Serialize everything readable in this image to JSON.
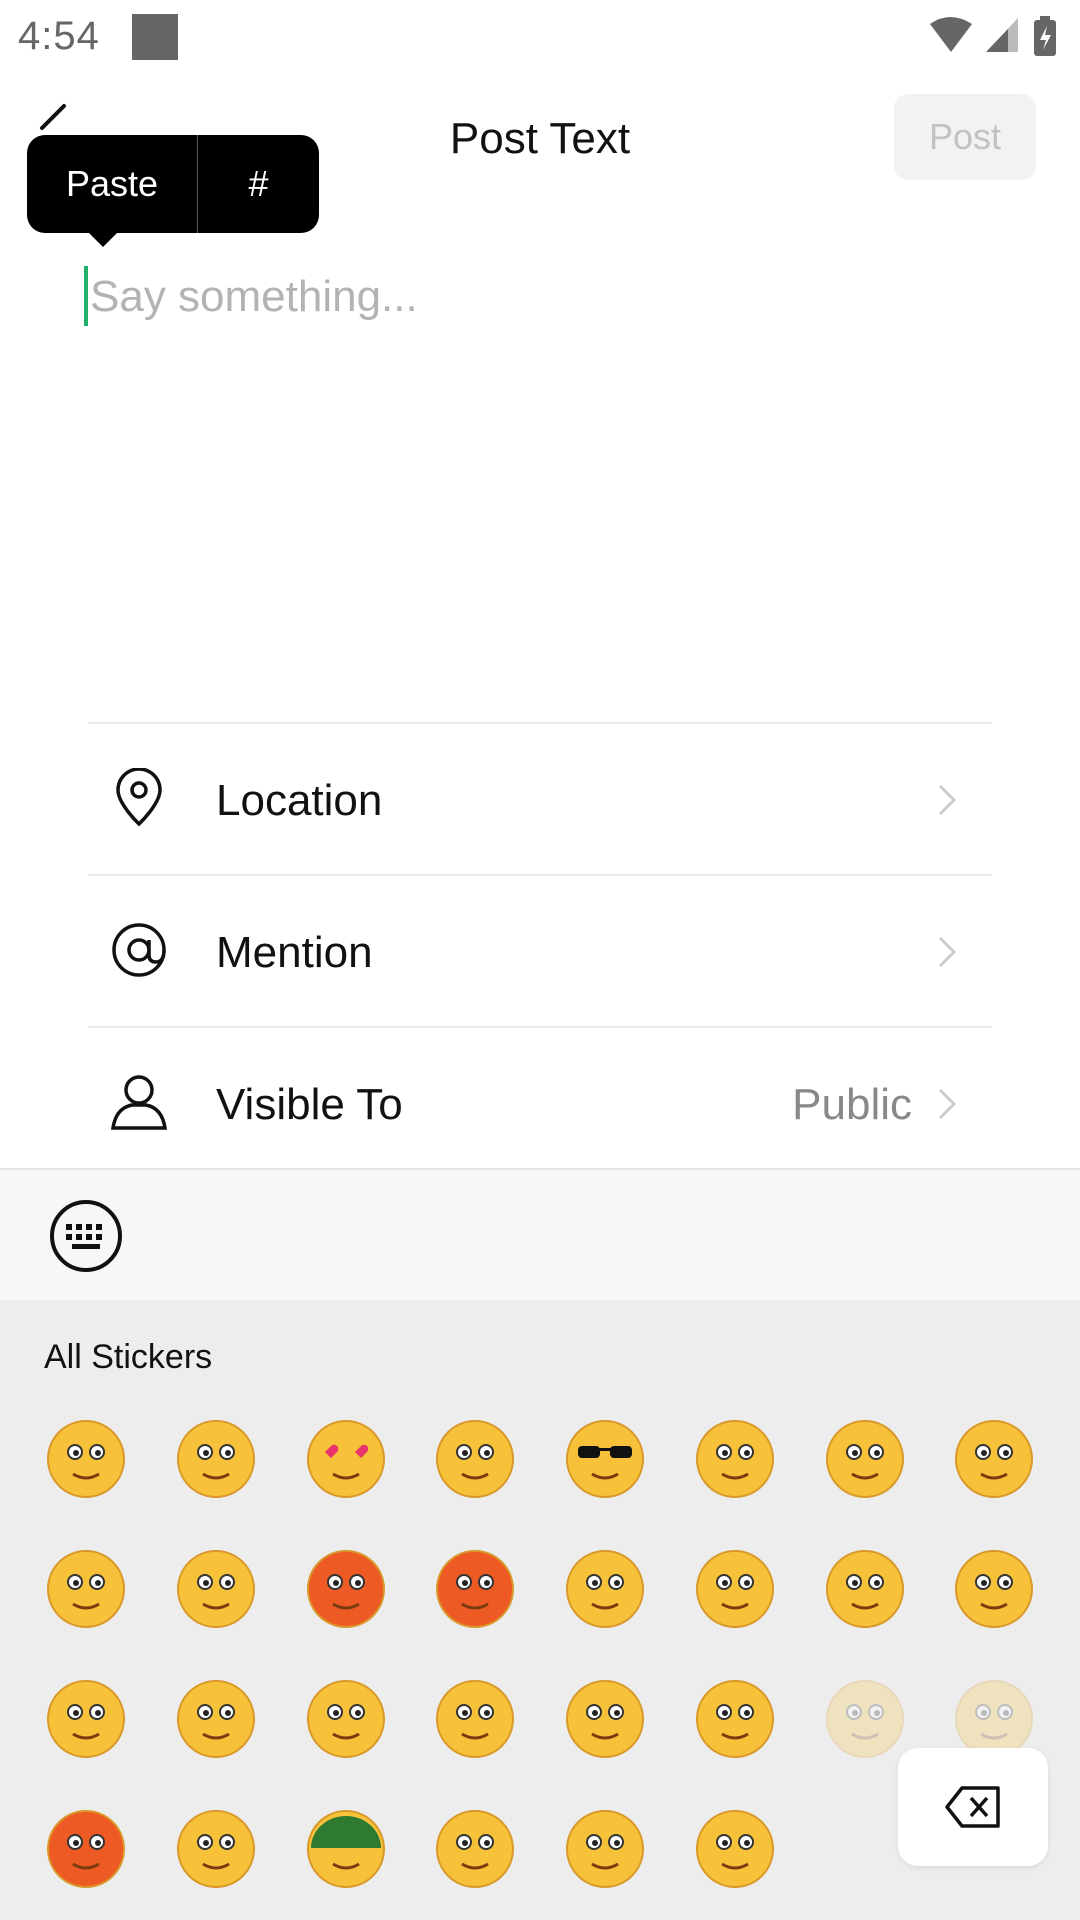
{
  "status_bar": {
    "time": "4:54"
  },
  "header": {
    "title": "Post Text",
    "post_label": "Post"
  },
  "popup": {
    "paste": "Paste",
    "hash": "#"
  },
  "composer": {
    "placeholder": "Say something..."
  },
  "options": [
    {
      "label": "Location",
      "icon": "location-pin-icon",
      "value": ""
    },
    {
      "label": "Mention",
      "icon": "at-sign-icon",
      "value": ""
    },
    {
      "label": "Visible To",
      "icon": "person-icon",
      "value": "Public"
    }
  ],
  "stickers": {
    "title": "All Stickers",
    "items": [
      "smile-sticker",
      "worried-sticker",
      "heart-eyes-sticker",
      "frown-sticker",
      "sunglasses-sticker",
      "crying-sticker",
      "blush-sticker",
      "mouth-crossed-sticker",
      "sleepy-sticker",
      "tears-sticker",
      "angry-sweat-sticker",
      "furious-sticker",
      "wink-tongue-sticker",
      "grin-sticker",
      "shocked-sticker",
      "sad-sticker",
      "blushing-worried-sticker",
      "laughing-sticker",
      "nauseous-sticker",
      "hand-over-mouth-sticker",
      "smirk-sticker",
      "surprised-sticker",
      "rolling-eyes-sticker",
      "unamused-sticker",
      "scared-sweat-sticker",
      "big-grin-sticker",
      "helmet-sticker",
      "crying-angry-sticker",
      "confused-question-sticker",
      "shush-sticker"
    ]
  },
  "colors": {
    "accent": "#1db16a",
    "face": "#f7c23a"
  }
}
